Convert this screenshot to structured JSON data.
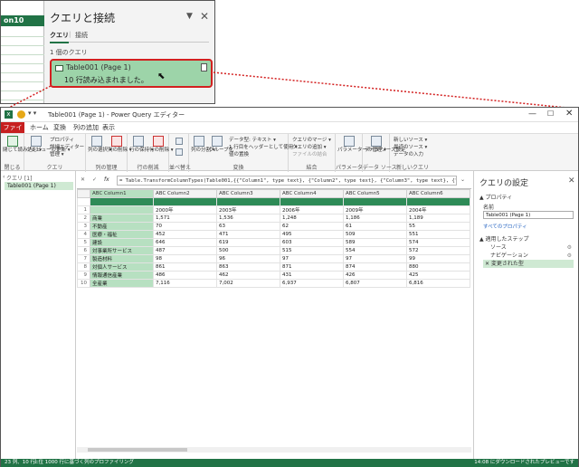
{
  "excel_pane": {
    "sheet_cell": "on10",
    "title": "クエリと接続",
    "tabs": [
      "クエリ",
      "接続"
    ],
    "query_count": "1 個のクエリ",
    "query_card": {
      "name": "Table001 (Page 1)",
      "status": "10 行読み込まれました。"
    }
  },
  "window": {
    "title": "Table001 (Page 1) - Power Query エディター",
    "qat_more": "▾ ▾"
  },
  "menu": {
    "file": "ファイル",
    "items": [
      "ホーム",
      "変換",
      "列の追加",
      "表示"
    ]
  },
  "ribbon": {
    "groups": [
      {
        "label": "閉じる",
        "buttons": [
          "閉じて読み込む ▾"
        ]
      },
      {
        "label": "クエリ",
        "buttons": [
          "プレビューの更新 ▾"
        ],
        "small": [
          "プロパティ",
          "詳細エディター",
          "管理 ▾"
        ]
      },
      {
        "label": "列の管理",
        "buttons": [
          "列の選択 ▾",
          "列の削除 ▾"
        ]
      },
      {
        "label": "行の削減",
        "buttons": [
          "行の保持 ▾",
          "行の削除 ▾"
        ]
      },
      {
        "label": "並べ替え",
        "buttons": []
      },
      {
        "label": "変換",
        "buttons": [
          "列の分割 ▾",
          "グループ化"
        ],
        "small": [
          "データ型: テキスト ▾",
          "1 行目をヘッダーとして使用 ▾",
          "値の置換"
        ]
      },
      {
        "label": "結合",
        "small": [
          "クエリのマージ ▾",
          "クエリの追加 ▾",
          "ファイルの結合"
        ]
      },
      {
        "label": "パラメーター",
        "buttons": [
          "パラメーターの管理 ▾"
        ]
      },
      {
        "label": "データ ソース",
        "buttons": [
          "データ ソース設定"
        ]
      },
      {
        "label": "新しいクエリ",
        "small": [
          "新しいソース ▾",
          "最近のソース ▾",
          "データの入力"
        ]
      }
    ]
  },
  "query_list": {
    "label": "クエリ [1]",
    "items": [
      "Table001 (Page 1)"
    ]
  },
  "formula_bar": {
    "cancel": "✕",
    "ok": "✓",
    "fx": "fx",
    "formula": "= Table.TransformColumnTypes(Table001,{{\"Column1\", type text}, {\"Column2\", type text}, {\"Column3\", type text}, {\"Column4\", type text}, {\"Column5\", type text}, {\"Column6\""
  },
  "grid": {
    "columns": [
      "Column1",
      "Column2",
      "Column3",
      "Column4",
      "Column5",
      "Column6"
    ],
    "col_type": "ABC",
    "rows": [
      [
        "1",
        "",
        "2000年",
        "2003年",
        "2006年",
        "2009年",
        "2004年"
      ],
      [
        "2",
        "商業",
        "1,571",
        "1,536",
        "1,248",
        "1,186",
        "1,189"
      ],
      [
        "3",
        "不動産",
        "70",
        "63",
        "62",
        "61",
        "55"
      ],
      [
        "4",
        "医療・福祉",
        "452",
        "471",
        "495",
        "509",
        "551"
      ],
      [
        "5",
        "建設",
        "646",
        "619",
        "603",
        "589",
        "574"
      ],
      [
        "6",
        "対事業所サービス",
        "487",
        "500",
        "515",
        "554",
        "572"
      ],
      [
        "7",
        "製造材料",
        "98",
        "96",
        "97",
        "97",
        "99"
      ],
      [
        "8",
        "対個人サービス",
        "861",
        "863",
        "871",
        "874",
        "880"
      ],
      [
        "9",
        "情報通信産業",
        "486",
        "462",
        "431",
        "426",
        "425"
      ],
      [
        "10",
        "全産業",
        "7,116",
        "7,002",
        "6,937",
        "6,807",
        "6,816"
      ]
    ]
  },
  "settings": {
    "title": "クエリの設定",
    "properties_title": "▲ プロパティ",
    "name_label": "名前",
    "name_value": "Table001 (Page 1)",
    "all_properties": "すべてのプロパティ",
    "steps_title": "▲ 適用したステップ",
    "steps": [
      "ソース",
      "ナビゲーション",
      "✕ 変更された型"
    ]
  },
  "status": {
    "left": "23 列、10 行",
    "mid": "上位 1000 行に基づく列のプロファイリング",
    "right": "14:08 にダウンロードされたプレビューです"
  }
}
